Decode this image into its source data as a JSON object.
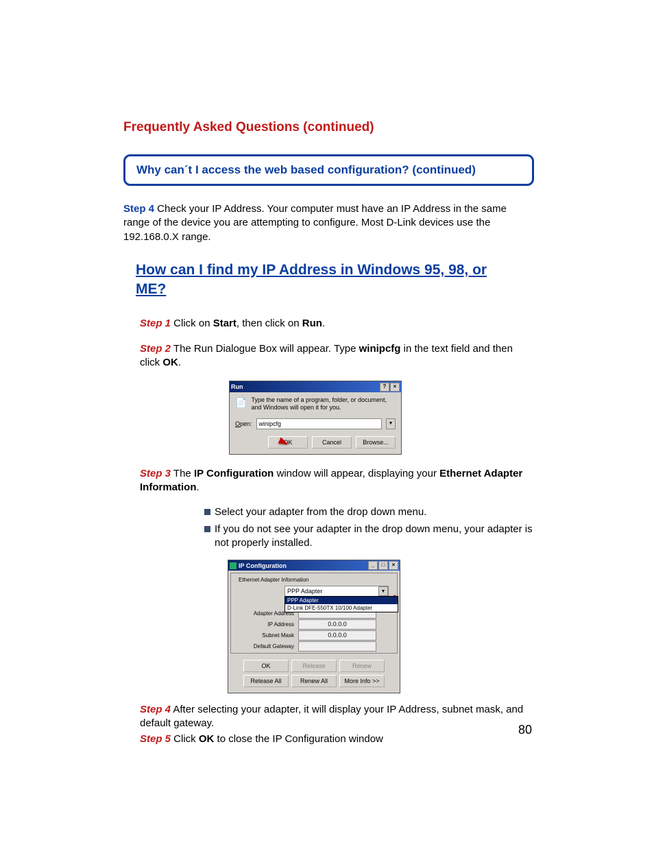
{
  "header": "Frequently Asked Questions (continued)",
  "callout": "Why can´t I access the web based configuration? (continued)",
  "step4_top": {
    "label": "Step 4",
    "text": " Check your IP Address. Your computer must have an IP Address in the same range of the device you are attempting to configure. Most D-Link devices use the 192.168.0.X range."
  },
  "subheading": "How can I find my IP Address in Windows 95, 98, or ME?",
  "step1": {
    "label": "Step 1",
    "t1": " Click on ",
    "b1": "Start",
    "t2": ", then click on ",
    "b2": "Run",
    "t3": "."
  },
  "step2": {
    "label": "Step 2",
    "t1": " The Run Dialogue Box will appear. Type ",
    "b1": "winipcfg",
    "t2": " in the text field and then click ",
    "b2": "OK",
    "t3": "."
  },
  "run": {
    "title": "Run",
    "desc": "Type the name of a program, folder, or document, and Windows will open it for you.",
    "open_label_u": "O",
    "open_label_rest": "pen:",
    "input": "winipcfg",
    "ok": "OK",
    "cancel": "Cancel",
    "browse": "Browse...",
    "help": "?",
    "close": "×"
  },
  "step3": {
    "label": "Step 3",
    "t1": " The ",
    "b1": "IP Configuration",
    "t2": " window will appear, displaying your ",
    "b2": "Ethernet Adapter Information",
    "t3": "."
  },
  "bullets": [
    "Select your adapter from the drop down menu.",
    "If you do not see your adapter in the drop down menu, your adapter is not properly installed."
  ],
  "ipcfg": {
    "title": "IP Configuration",
    "group": "Ethernet Adapter Information",
    "selected": "PPP Adapter",
    "options": [
      "PPP Adapter",
      "D-Link DFE-550TX 10/100 Adapter"
    ],
    "rows": {
      "adapter_addr_label": "Adapter Address",
      "adapter_addr_val": "",
      "ip_label": "IP Address",
      "ip_val": "0.0.0.0",
      "subnet_label": "Subnet Mask",
      "subnet_val": "0.0.0.0",
      "gateway_label": "Default Gateway",
      "gateway_val": ""
    },
    "buttons": {
      "ok": "OK",
      "release": "Release",
      "renew": "Renew",
      "release_all": "Release All",
      "renew_all": "Renew All",
      "more": "More Info >>"
    },
    "min": "_",
    "max": "□",
    "close": "×"
  },
  "step4": {
    "label": "Step 4",
    "text": "  After selecting your adapter, it will display your IP Address, subnet mask, and default gateway."
  },
  "step5": {
    "label": "Step 5",
    "t1": "  Click ",
    "b1": "OK",
    "t2": " to close the IP Configuration window"
  },
  "page_number": "80"
}
